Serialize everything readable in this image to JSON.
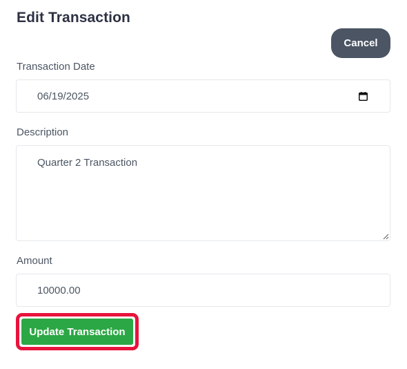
{
  "form": {
    "title": "Edit Transaction",
    "cancel_label": "Cancel",
    "date_label": "Transaction Date",
    "date_value": "06/19/2025",
    "description_label": "Description",
    "description_value": "Quarter 2 Transaction",
    "amount_label": "Amount",
    "amount_value": "10000.00",
    "submit_label": "Update Transaction"
  },
  "colors": {
    "cancel_button": "#4b5563",
    "submit_button": "#2ca745",
    "highlight": "#e8133c",
    "title": "#2d3142"
  },
  "icons": {
    "date_picker": "calendar-icon",
    "textarea_resize": "resize-handle-icon"
  }
}
